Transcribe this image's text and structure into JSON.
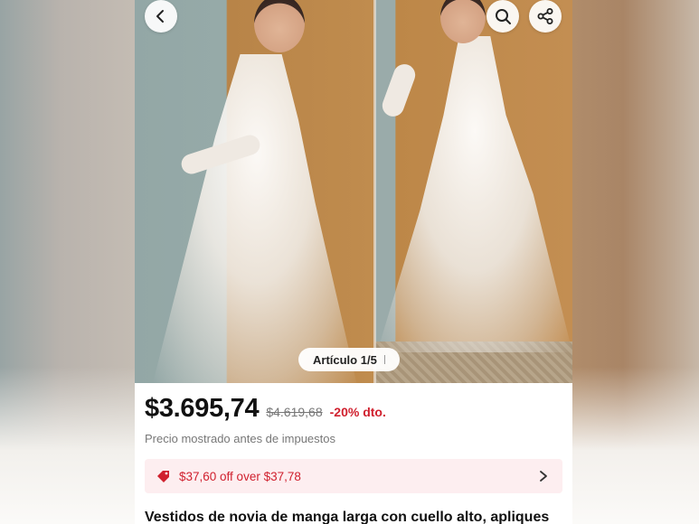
{
  "colors": {
    "accent_red": "#d0202e",
    "coupon_bg": "#fdeef0",
    "text_primary": "#111111",
    "text_muted": "#777777"
  },
  "nav": {
    "back_icon": "chevron-left-icon",
    "search_icon": "search-icon",
    "share_icon": "share-icon"
  },
  "gallery": {
    "counter_label": "Artículo 1/5"
  },
  "product": {
    "price": "$3.695,74",
    "original_price": "$4.619,68",
    "discount": "-20% dto.",
    "tax_note": "Precio mostrado antes de impuestos",
    "coupon_text": "$37,60 off over $37,78",
    "coupon_icon": "tag-icon",
    "title": "Vestidos de novia de manga larga con cuello alto, apliques"
  }
}
